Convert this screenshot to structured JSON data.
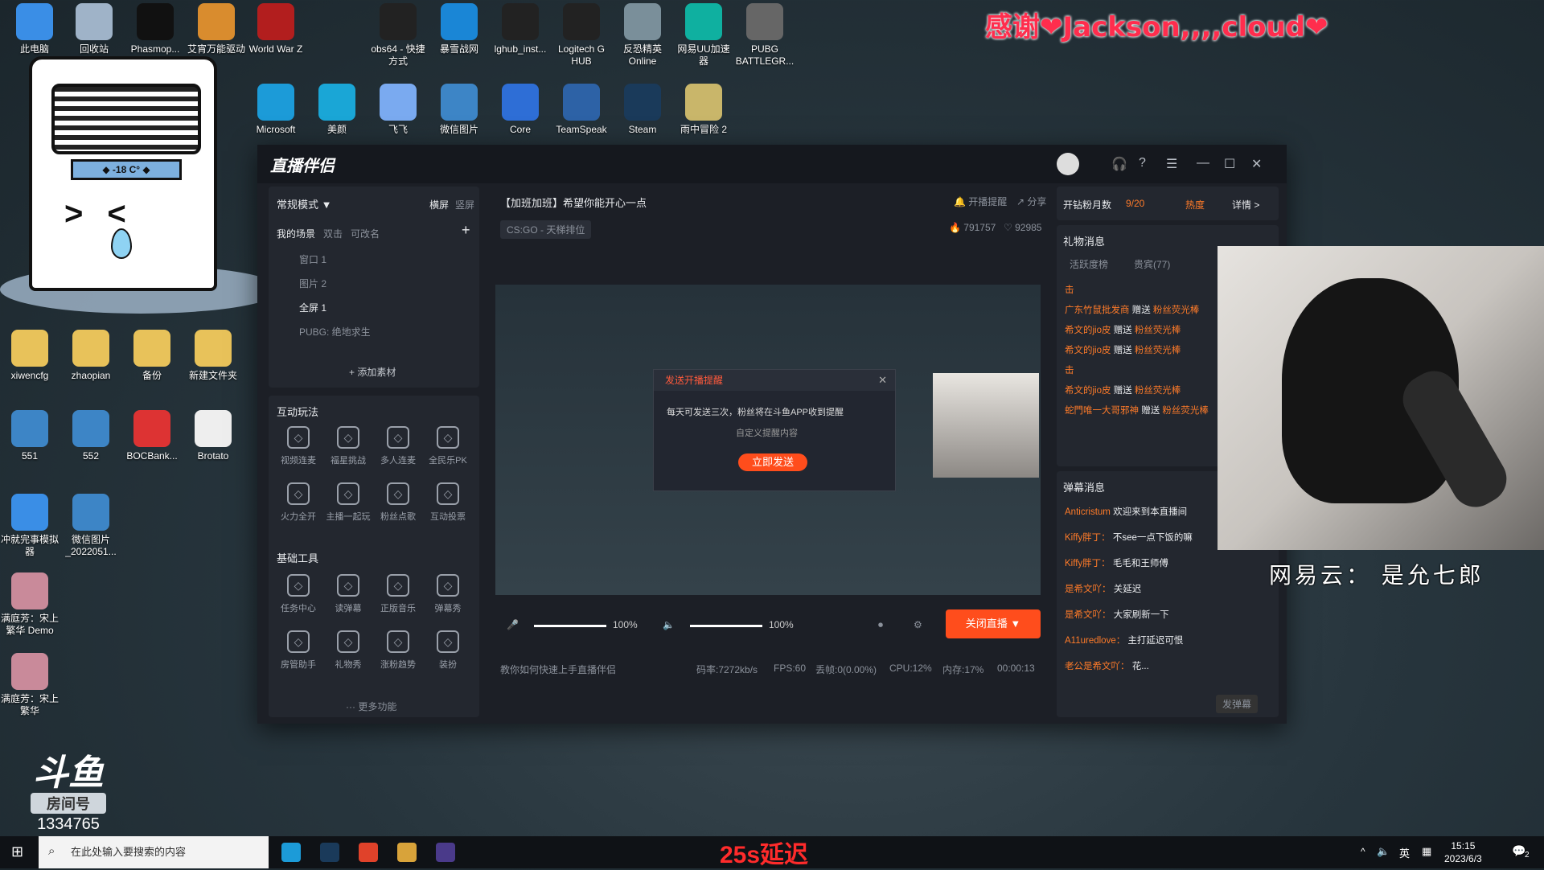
{
  "banner": "感谢❤Jackson,,,,cloud❤",
  "desktop_icons": [
    {
      "label": "此电脑",
      "icon": "computer-icon",
      "color": "#3a8ee6"
    },
    {
      "label": "回收站",
      "icon": "recycle-bin-icon",
      "color": "#9fb3c8"
    },
    {
      "label": "Phasmop...",
      "icon": "game-icon",
      "color": "#111111"
    },
    {
      "label": "艾宵万能驱动",
      "icon": "driver-icon",
      "color": "#d98c2e"
    },
    {
      "label": "World War Z",
      "icon": "wwz-icon",
      "color": "#b21e1e"
    },
    {
      "label": "obs64 - 快捷方式",
      "icon": "obs-icon",
      "color": "#222222"
    },
    {
      "label": "暴雪战网",
      "icon": "battlenet-icon",
      "color": "#1a86d6"
    },
    {
      "label": "lghub_inst...",
      "icon": "logitech-icon",
      "color": "#222222"
    },
    {
      "label": "Logitech G HUB",
      "icon": "logitech-icon",
      "color": "#222222"
    },
    {
      "label": "反恐精英 Online",
      "icon": "csol-icon",
      "color": "#7a8f9a"
    },
    {
      "label": "网易UU加速器",
      "icon": "uu-icon",
      "color": "#0fb0a0"
    },
    {
      "label": "PUBG BATTLEGR...",
      "icon": "pubg-icon",
      "color": "#666666"
    },
    {
      "label": "Microsoft",
      "icon": "edge-icon",
      "color": "#1c9bd8"
    },
    {
      "label": "美颜",
      "icon": "beauty-icon",
      "color": "#1aa6d6"
    },
    {
      "label": "飞飞",
      "icon": "wing-icon",
      "color": "#7aaaf0"
    },
    {
      "label": "微信图片",
      "icon": "image-icon",
      "color": "#3d85c6"
    },
    {
      "label": "Core",
      "icon": "core-icon",
      "color": "#2e6ed6"
    },
    {
      "label": "TeamSpeak",
      "icon": "teamspeak-icon",
      "color": "#2d62a6"
    },
    {
      "label": "Steam",
      "icon": "steam-icon",
      "color": "#1a3a5a"
    },
    {
      "label": "雨中冒险 2",
      "icon": "ror2-icon",
      "color": "#c9b66a"
    },
    {
      "label": "xiwencfg",
      "icon": "folder-icon",
      "color": "#e8c25a"
    },
    {
      "label": "zhaopian",
      "icon": "folder-icon",
      "color": "#e8c25a"
    },
    {
      "label": "备份",
      "icon": "folder-icon",
      "color": "#e8c25a"
    },
    {
      "label": "新建文件夹",
      "icon": "folder-icon",
      "color": "#e8c25a"
    },
    {
      "label": "551",
      "icon": "image-icon",
      "color": "#3d85c6"
    },
    {
      "label": "552",
      "icon": "image-icon",
      "color": "#3d85c6"
    },
    {
      "label": "BOCBank...",
      "icon": "bank-icon",
      "color": "#d33"
    },
    {
      "label": "Brotato",
      "icon": "file-icon",
      "color": "#eeeeee"
    },
    {
      "label": "冲就完事模拟器",
      "icon": "lightning-icon",
      "color": "#3a8ee6"
    },
    {
      "label": "微信图片_2022051...",
      "icon": "image-icon",
      "color": "#3d85c6"
    },
    {
      "label": "满庭芳：宋上繁华 Demo",
      "icon": "game-icon",
      "color": "#c98a9a"
    },
    {
      "label": "满庭芳：宋上繁华",
      "icon": "game-icon",
      "color": "#c98a9a"
    }
  ],
  "mascot": {
    "temp": "◆ -18 C° ◆"
  },
  "app": {
    "logo": "直播伴侣",
    "mode": "常规模式 ▼",
    "orientation": [
      "横屏",
      "竖屏"
    ],
    "scene_tabs": [
      "我的场景",
      "双击",
      "可改名"
    ],
    "sources": [
      "窗口 1",
      "图片 2",
      "全屏 1",
      "PUBG: 绝地求生"
    ],
    "add_source": "+ 添加素材",
    "section_interactive": "互动玩法",
    "interactive_tools": [
      "视频连麦",
      "福星挑战",
      "多人连麦",
      "全民乐PK",
      "火力全开",
      "主播一起玩",
      "粉丝点歌",
      "互动投票"
    ],
    "section_basic": "基础工具",
    "basic_tools": [
      "任务中心",
      "读弹幕",
      "正版音乐",
      "弹幕秀",
      "房管助手",
      "礼物秀",
      "涨粉趋势",
      "装扮"
    ],
    "more": "··· 更多功能",
    "stream_title": "【加班加班】希望你能开心一点",
    "category": "CS:GO - 天梯排位",
    "notify": "开播提醒",
    "share": "分享",
    "hot_count": "791757",
    "likes": "92985",
    "dialog": {
      "title": "发送开播提醒",
      "line1": "每天可发送三次，粉丝将在斗鱼APP收到提醒",
      "line2": "自定义提醒内容",
      "button": "立即发送"
    },
    "mic_volume": "100%",
    "speaker_volume": "100%",
    "stop_button": "关闭直播 ▼",
    "tip": "教你如何快速上手直播伴侣",
    "stats": {
      "bitrate": "码率:7272kb/s",
      "fps": "FPS:60",
      "drop": "丢帧:0(0.00%)",
      "cpu": "CPU:12%",
      "mem": "内存:17%",
      "time": "00:00:13"
    },
    "fans": {
      "label": "开钻粉月数",
      "value": "9/20",
      "heat": "热度",
      "detail": "详情 >"
    },
    "gift_title": "礼物消息",
    "gift_tabs": [
      "活跃度榜",
      "贵宾(77)"
    ],
    "gifts": [
      {
        "user": "击",
        "action": "",
        "item": ""
      },
      {
        "user": "广东竹鼠批发商",
        "action": "赠送",
        "item": "粉丝荧光棒"
      },
      {
        "user": "希文的jio皮",
        "action": "赠送",
        "item": "粉丝荧光棒"
      },
      {
        "user": "希文的jio皮",
        "action": "赠送",
        "item": "粉丝荧光棒"
      },
      {
        "user": "击",
        "action": "",
        "item": ""
      },
      {
        "user": "希文的jio皮",
        "action": "赠送",
        "item": "粉丝荧光棒"
      },
      {
        "user": "蛇門唯一大哥邪神",
        "action": "赠送",
        "item": "粉丝荧光棒"
      }
    ],
    "danmu_title": "弹幕消息",
    "danmu": [
      {
        "user": "Anticristum",
        "text": "欢迎来到本直播间"
      },
      {
        "user": "Kiffy胖丁：",
        "text": "不see一点下饭的嘛"
      },
      {
        "user": "Kiffy胖丁：",
        "text": "毛毛和王师傅"
      },
      {
        "user": "是希文吖：",
        "text": "关延迟"
      },
      {
        "user": "是希文吖：",
        "text": "大家刷新一下"
      },
      {
        "user": "A11uredlove：",
        "text": "主打延迟可恨"
      },
      {
        "user": "老公是希文吖：",
        "text": "花..."
      }
    ],
    "send_danmu": "发弹幕"
  },
  "cam_caption": "网易云： 是允七郎",
  "douyu": {
    "logo": "斗鱼",
    "tag": "房间号",
    "room": "1334765"
  },
  "taskbar": {
    "search_placeholder": "在此处输入要搜索的内容",
    "delay": "25s延迟",
    "ime": "英",
    "time": "15:15",
    "date": "2023/6/3",
    "notify_count": "2"
  }
}
